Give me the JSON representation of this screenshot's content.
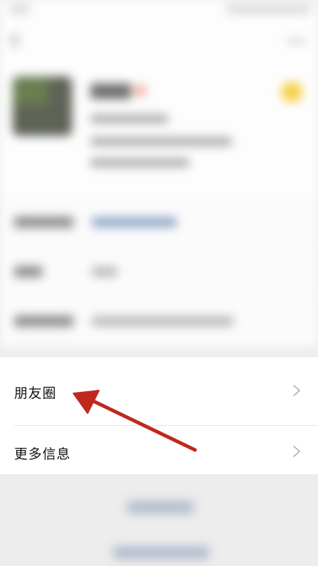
{
  "menu": {
    "moments_label": "朋友圈",
    "more_info_label": "更多信息"
  },
  "icons": {
    "chevron": "chevron-right-icon",
    "annotation": "arrow-annotation-icon"
  },
  "colors": {
    "annotation_arrow": "#c0281e",
    "chevron": "#b3b3b3",
    "panel_background": "#ffffff",
    "dimmed_background": "#ededed"
  }
}
